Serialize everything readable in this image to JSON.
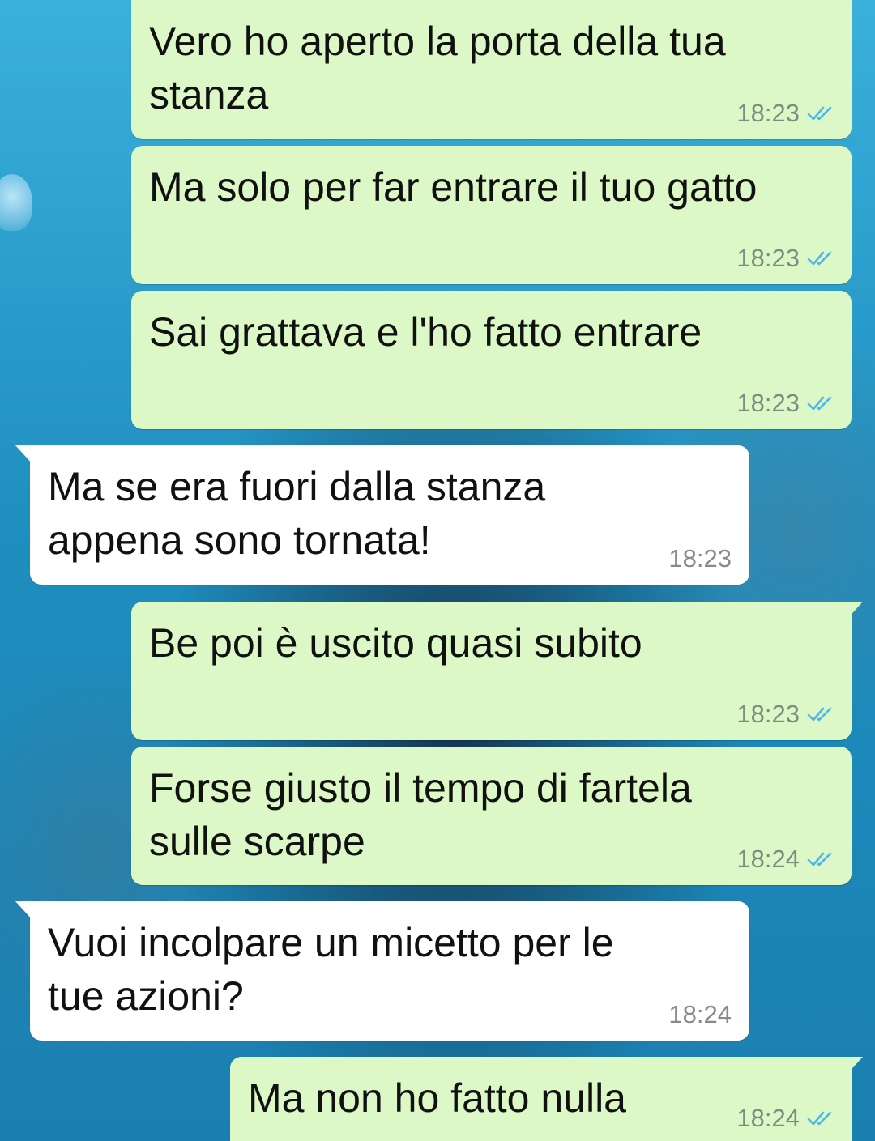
{
  "messages": [
    {
      "text": "Vero ho aperto la porta della tua\nstanza",
      "time": "18:23",
      "status": "read"
    },
    {
      "text": "Ma solo per far entrare il tuo gatto",
      "time": "18:23",
      "status": "read"
    },
    {
      "text": "Sai grattava e l'ho fatto entrare",
      "time": "18:23",
      "status": "read"
    },
    {
      "text": "Ma se era fuori dalla stanza\nappena sono tornata!",
      "time": "18:23"
    },
    {
      "text": "Be poi è uscito quasi subito",
      "time": "18:23",
      "status": "read"
    },
    {
      "text": "Forse giusto il tempo di fartela\nsulle scarpe",
      "time": "18:24",
      "status": "read"
    },
    {
      "text": "Vuoi incolpare un micetto per le\ntue azioni?",
      "time": "18:24"
    },
    {
      "text": "Ma non ho fatto nulla",
      "time": "18:24",
      "status": "read"
    }
  ],
  "colors": {
    "outgoing_bubble": "#dcf8c6",
    "incoming_bubble": "#ffffff",
    "read_ticks": "#4fb6ec",
    "wallpaper": "#2a9fc8"
  },
  "icons": {
    "read_status": "double-check-icon"
  }
}
